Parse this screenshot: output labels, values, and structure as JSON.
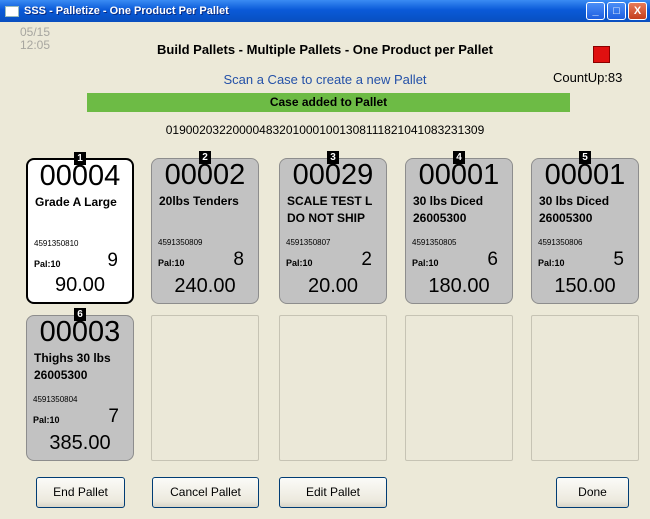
{
  "window": {
    "title": "SSS - Palletize - One Product Per Pallet",
    "buttons": {
      "minimize": "_",
      "maximize": "□",
      "close": "X"
    }
  },
  "header": {
    "date": "05/15",
    "time": "12:05",
    "title": "Build Pallets - Multiple Pallets - One Product per Pallet",
    "prompt": "Scan a Case to create a new Pallet",
    "count_label": "CountUp:83",
    "indicator_color": "#e01010"
  },
  "status": {
    "message": "Case added to Pallet",
    "color": "#6dbb45"
  },
  "barcode": "0190020322000048320100010013081118210410832313​09",
  "pallets": [
    {
      "badge": "1",
      "number": "00004",
      "line1": "Grade A Large",
      "line2": "",
      "serial": "4591350810",
      "pal": "Pal:10",
      "count": "9",
      "weight": "90.00",
      "selected": true
    },
    {
      "badge": "2",
      "number": "00002",
      "line1": "20lbs Tenders",
      "line2": "",
      "serial": "4591350809",
      "pal": "Pal:10",
      "count": "8",
      "weight": "240.00",
      "selected": false
    },
    {
      "badge": "3",
      "number": "00029",
      "line1": "SCALE TEST L",
      "line2": "DO NOT SHIP",
      "serial": "4591350807",
      "pal": "Pal:10",
      "count": "2",
      "weight": "20.00",
      "selected": false
    },
    {
      "badge": "4",
      "number": "00001",
      "line1": "30 lbs Diced",
      "line2": "26005300",
      "serial": "4591350805",
      "pal": "Pal:10",
      "count": "6",
      "weight": "180.00",
      "selected": false
    },
    {
      "badge": "5",
      "number": "00001",
      "line1": "30 lbs Diced",
      "line2": "26005300",
      "serial": "4591350806",
      "pal": "Pal:10",
      "count": "5",
      "weight": "150.00",
      "selected": false
    },
    {
      "badge": "6",
      "number": "00003",
      "line1": "Thighs 30 lbs",
      "line2": "26005300",
      "serial": "4591350804",
      "pal": "Pal:10",
      "count": "7",
      "weight": "385.00",
      "selected": false
    }
  ],
  "actions": {
    "end_pallet": "End Pallet",
    "cancel_pallet": "Cancel Pallet",
    "edit_pallet": "Edit Pallet",
    "done": "Done"
  }
}
